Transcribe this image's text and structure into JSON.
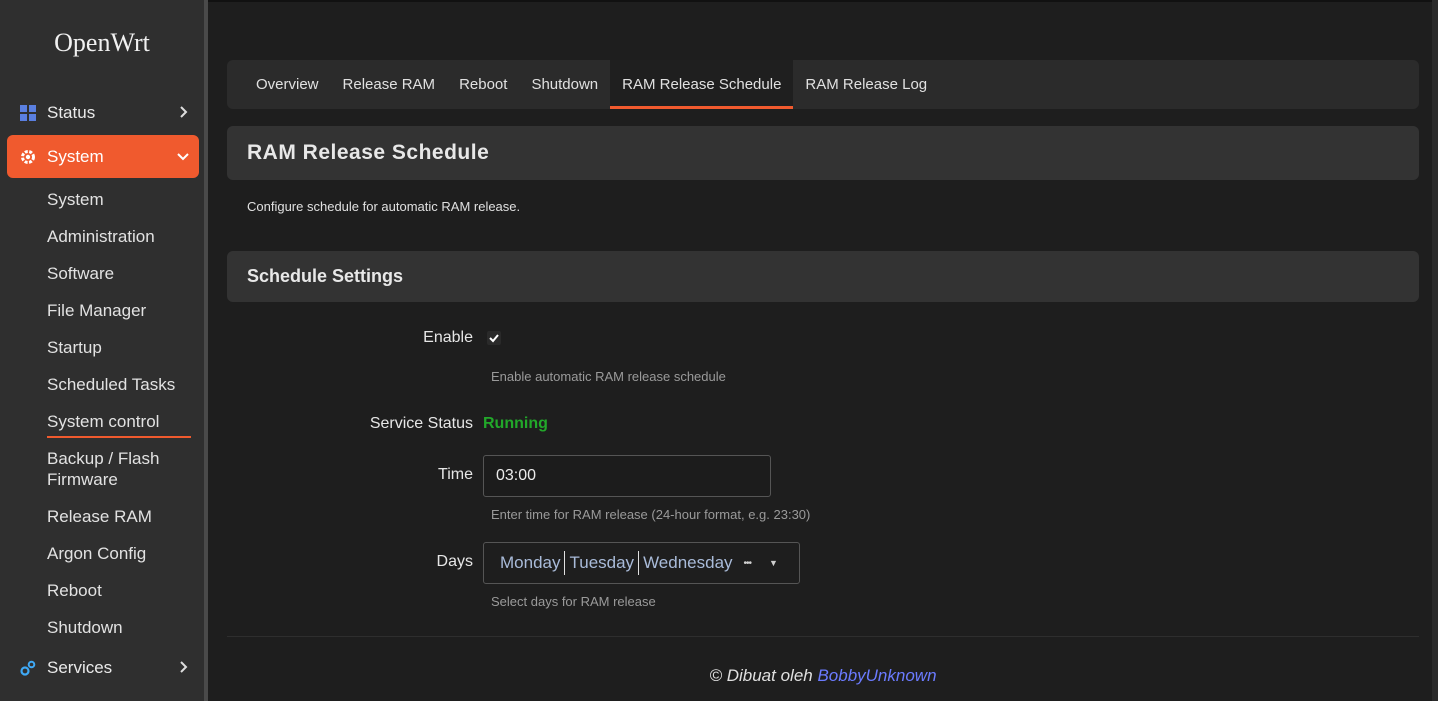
{
  "brand": "OpenWrt",
  "sidebar": {
    "top": [
      {
        "label": "Status",
        "icon": "grid-icon"
      },
      {
        "label": "System",
        "icon": "gear-icon",
        "active": true
      },
      {
        "label": "Services",
        "icon": "services-icon"
      }
    ],
    "system_items": [
      "System",
      "Administration",
      "Software",
      "File Manager",
      "Startup",
      "Scheduled Tasks",
      "System control",
      "Backup / Flash Firmware",
      "Release RAM",
      "Argon Config",
      "Reboot",
      "Shutdown"
    ]
  },
  "tabs": [
    "Overview",
    "Release RAM",
    "Reboot",
    "Shutdown",
    "RAM Release Schedule",
    "RAM Release Log"
  ],
  "active_tab": "RAM Release Schedule",
  "page": {
    "title": "RAM Release Schedule",
    "description": "Configure schedule for automatic RAM release.",
    "section_title": "Schedule Settings"
  },
  "form": {
    "enable": {
      "label": "Enable",
      "checked": true,
      "help": "Enable automatic RAM release schedule"
    },
    "status": {
      "label": "Service Status",
      "value": "Running"
    },
    "time": {
      "label": "Time",
      "value": "03:00",
      "help": "Enter time for RAM release (24-hour format, e.g. 23:30)"
    },
    "days": {
      "label": "Days",
      "selected": [
        "Monday",
        "Tuesday",
        "Wednesday"
      ],
      "more": "•••",
      "help": "Select days for RAM release"
    }
  },
  "footer": {
    "prefix": "© Dibuat oleh ",
    "author": "BobbyUnknown"
  },
  "colors": {
    "accent": "#f05a2e",
    "running": "#22a82a",
    "link": "#6b7bff"
  }
}
